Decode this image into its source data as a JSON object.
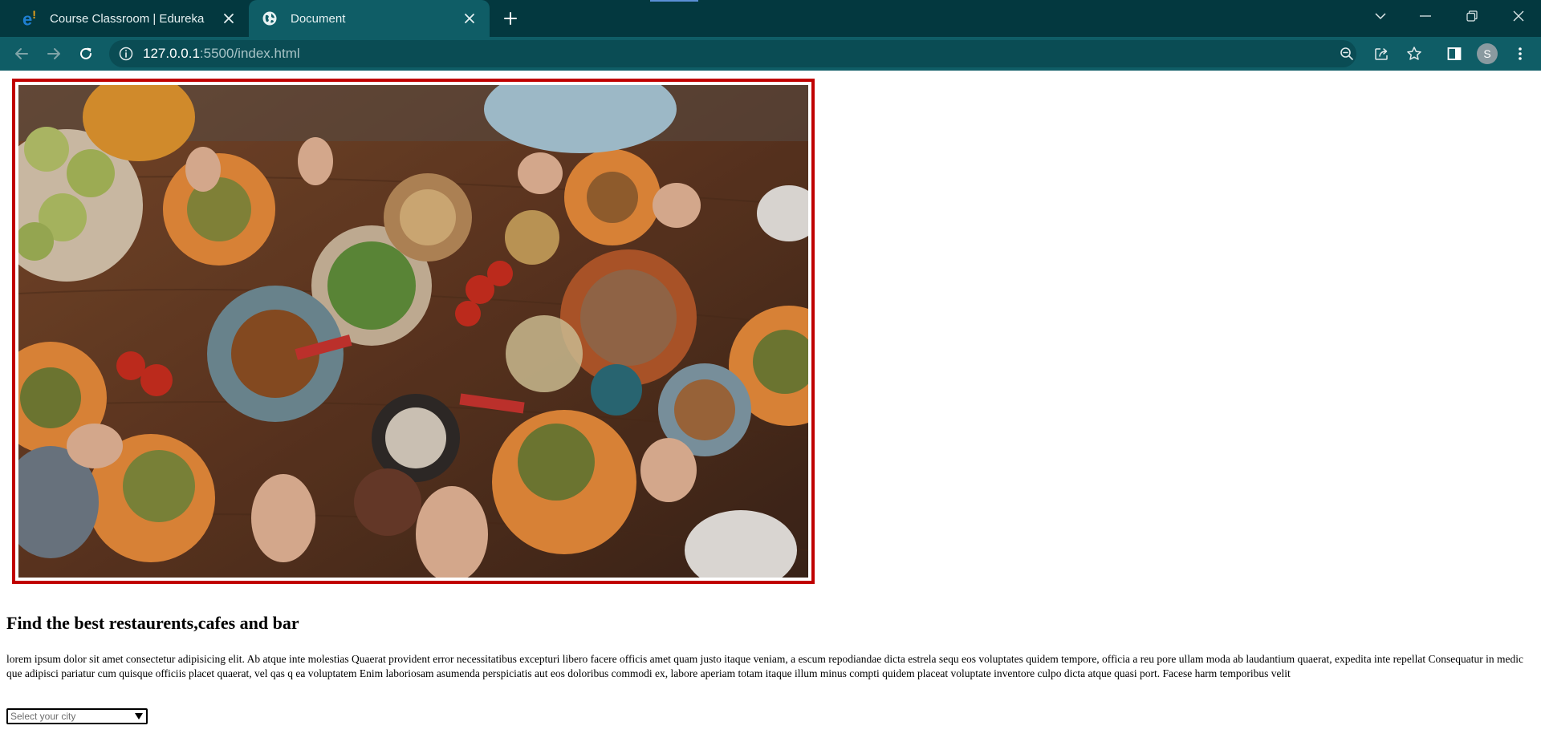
{
  "browser": {
    "tabs": [
      {
        "title": "Course Classroom | Edureka",
        "favicon": "edureka-logo",
        "active": false
      },
      {
        "title": "Document",
        "favicon": "globe-icon",
        "active": true
      }
    ],
    "address_bar": {
      "host": "127.0.0.1",
      "path": ":5500/index.html"
    },
    "profile_initial": "S",
    "theme_colors": {
      "tabbar": "#03383f",
      "toolbar": "#0f5d66",
      "omnibox": "#0a4c54"
    }
  },
  "page": {
    "hero_image_alt": "people sharing a table of food",
    "hero_border_color": "#c00000",
    "heading": "Find the best restaurents,cafes and bar",
    "paragraph": "lorem ipsum dolor sit amet consectetur adipisicing elit. Ab atque inte molestias Quaerat provident error necessitatibus excepturi libero facere officis amet quam justo itaque veniam, a escum repodiandae dicta estrela sequ eos voluptates quidem tempore, officia a reu pore ullam moda ab laudantium quaerat, expedita inte repellat Consequatur in medic que adipisci pariatur cum quisque officiis placet quaerat, vel qas q ea voluptatem Enim laboriosam asumenda perspiciatis aut eos doloribus commodi ex, labore aperiam totam itaque illum minus compti quidem placeat voluptate inventore culpo dicta atque quasi port. Facese harm temporibus velit",
    "city_select": {
      "selected": "Select your city"
    }
  }
}
